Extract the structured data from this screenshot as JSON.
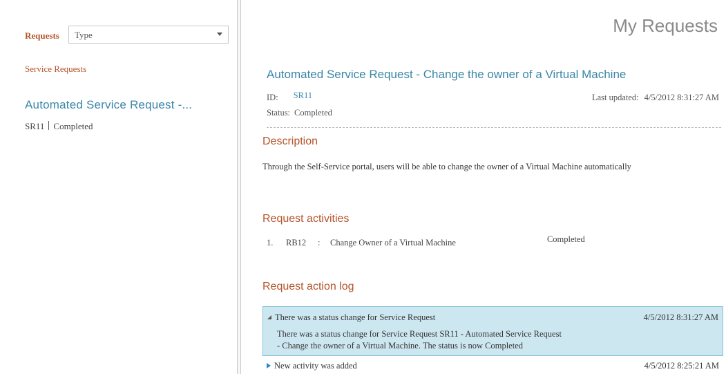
{
  "sidebar": {
    "filter_label": "Requests",
    "filter_value": "Type",
    "category": "Service Requests",
    "item": {
      "title": "Automated Service Request -...",
      "id": "SR11",
      "status": "Completed"
    }
  },
  "page": {
    "title": "My Requests"
  },
  "request": {
    "title": "Automated Service Request - Change the owner of a Virtual Machine",
    "id_label": "ID:",
    "id": "SR11",
    "updated_label": "Last updated:",
    "updated": "4/5/2012 8:31:27 AM",
    "status_label": "Status:",
    "status": "Completed"
  },
  "description": {
    "heading": "Description",
    "text": "Through the Self-Service portal, users will be able to change the owner of a Virtual Machine automatically"
  },
  "activities": {
    "heading": "Request activities",
    "items": [
      {
        "num": "1.",
        "code": "RB12",
        "sep": ":",
        "name": "Change Owner of a Virtual Machine",
        "status": "Completed"
      }
    ]
  },
  "action_log": {
    "heading": "Request action log",
    "entries": [
      {
        "title": "There was a status change for Service Request",
        "timestamp": "4/5/2012 8:31:27 AM",
        "detail_line1": "There was a status change for Service Request SR11 - Automated Service Request",
        "detail_line2": "- Change the owner of a Virtual Machine. The status is now Completed",
        "expanded": true
      },
      {
        "title": "New activity was added",
        "timestamp": "4/5/2012 8:25:21 AM",
        "expanded": false
      }
    ]
  },
  "colors": {
    "accent_orange": "#b4542a",
    "link_blue": "#3a86a8",
    "selection_bg": "#cde7f1"
  }
}
